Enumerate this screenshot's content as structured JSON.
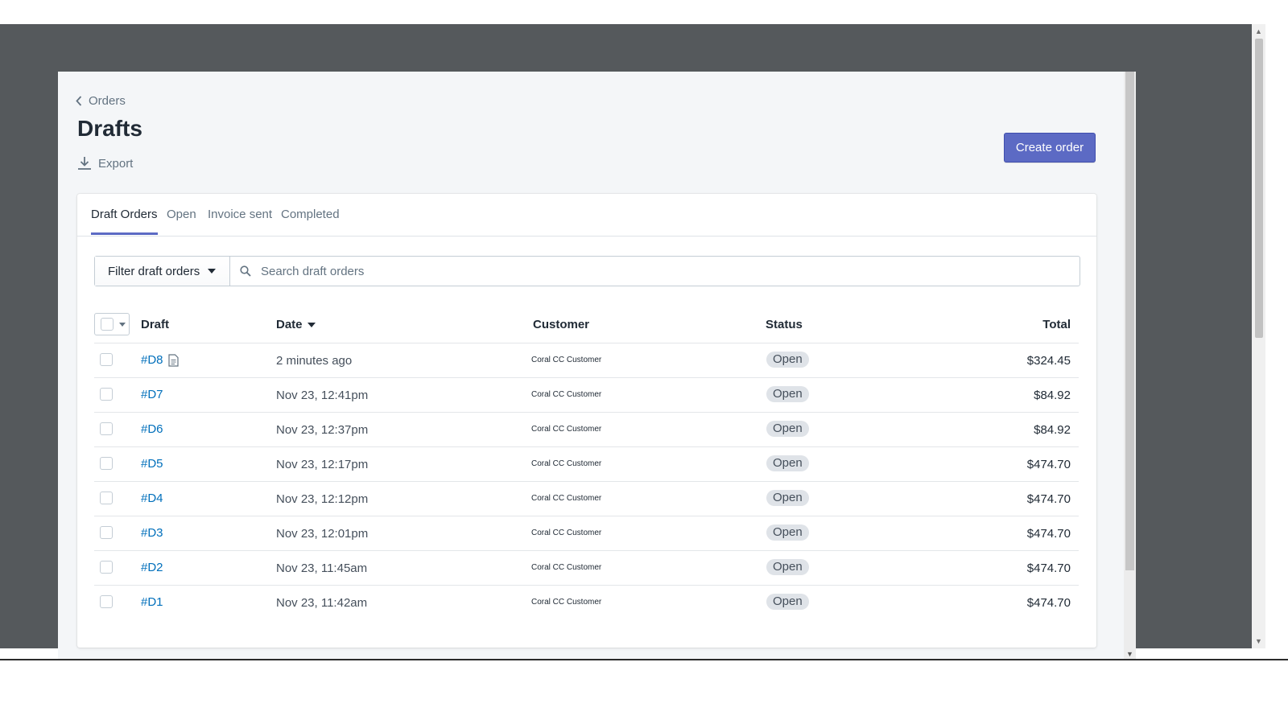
{
  "breadcrumb": {
    "label": "Orders"
  },
  "page": {
    "title": "Drafts",
    "export_label": "Export",
    "create_label": "Create order"
  },
  "tabs": [
    {
      "label": "Draft Orders",
      "active": true
    },
    {
      "label": "Open",
      "active": false
    },
    {
      "label": "Invoice sent",
      "active": false
    },
    {
      "label": "Completed",
      "active": false
    }
  ],
  "filter": {
    "label": "Filter draft orders",
    "search_placeholder": "Search draft orders"
  },
  "table": {
    "headers": {
      "draft": "Draft",
      "date": "Date",
      "customer": "Customer",
      "status": "Status",
      "total": "Total"
    },
    "rows": [
      {
        "draft": "#D8",
        "has_note": true,
        "date": "2 minutes ago",
        "customer": "Coral CC Customer",
        "status": "Open",
        "total": "$324.45"
      },
      {
        "draft": "#D7",
        "date": "Nov 23, 12:41pm",
        "customer": "Coral CC Customer",
        "status": "Open",
        "total": "$84.92"
      },
      {
        "draft": "#D6",
        "date": "Nov 23, 12:37pm",
        "customer": "Coral CC Customer",
        "status": "Open",
        "total": "$84.92"
      },
      {
        "draft": "#D5",
        "date": "Nov 23, 12:17pm",
        "customer": "Coral CC Customer",
        "status": "Open",
        "total": "$474.70"
      },
      {
        "draft": "#D4",
        "date": "Nov 23, 12:12pm",
        "customer": "Coral CC Customer",
        "status": "Open",
        "total": "$474.70"
      },
      {
        "draft": "#D3",
        "date": "Nov 23, 12:01pm",
        "customer": "Coral CC Customer",
        "status": "Open",
        "total": "$474.70"
      },
      {
        "draft": "#D2",
        "date": "Nov 23, 11:45am",
        "customer": "Coral CC Customer",
        "status": "Open",
        "total": "$474.70"
      },
      {
        "draft": "#D1",
        "date": "Nov 23, 11:42am",
        "customer": "Coral CC Customer",
        "status": "Open",
        "total": "$474.70"
      }
    ]
  },
  "colors": {
    "accent": "#5c6ac4",
    "link": "#006fbb",
    "backdrop": "#55595c",
    "badge": "#dfe3e8"
  }
}
